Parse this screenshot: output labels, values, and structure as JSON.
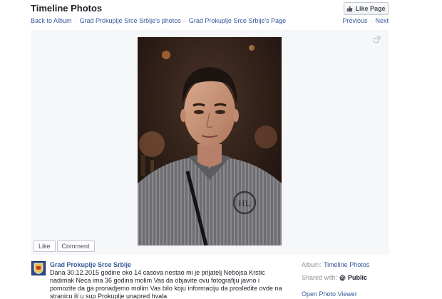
{
  "header": {
    "title": "Timeline Photos",
    "like_page_label": "Like Page"
  },
  "breadcrumb": {
    "back": "Back to Album",
    "separator": "·",
    "photos": "Grad Prokuplje Srce Srbije's photos",
    "page": "Grad Prokuplje Srce Srbije's Page"
  },
  "pager": {
    "previous": "Previous",
    "separator": "·",
    "next": "Next"
  },
  "actions": {
    "like": "Like",
    "comment": "Comment"
  },
  "post": {
    "author": "Grad Prokuplje Srce Srbije",
    "text": "Dana 30.12.2015 godine oko 14 casova nestao mi je prijatelj Nebojsa Krstic nadimak Neca ima 36 godina molim Vas da objavite ovu fotografiju javno i pomozite da ga pronadjemo molim Vas bilo koju informaciju da prosledite ovde na stranicu ili u sup Prokuplje unapred hvala"
  },
  "meta": {
    "album_label": "Album:",
    "album_value": "Timeline Photos",
    "shared_label": "Shared with:",
    "shared_value": "Public",
    "open_viewer": "Open Photo Viewer"
  },
  "icons": {
    "like_page": "thumbs-up-icon",
    "expand": "expand-icon",
    "public": "globe-icon",
    "avatar": "page-crest-avatar"
  },
  "colors": {
    "link": "#365899",
    "stage_bg": "#f6f7f9",
    "text": "#1d2129",
    "muted": "#90949c"
  }
}
